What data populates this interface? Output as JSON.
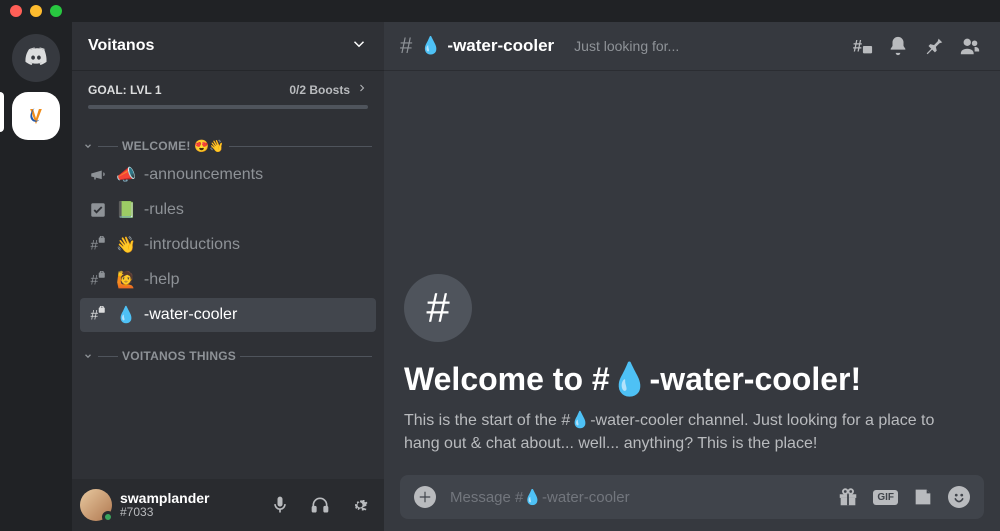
{
  "titlebar": {},
  "server_rail": {
    "home_label": "Home",
    "active_server_label": "Voitanos"
  },
  "sidebar": {
    "server_name": "Voitanos",
    "boost": {
      "goal_label": "GOAL: LVL 1",
      "count_label": "0/2 Boosts"
    },
    "categories": [
      {
        "label": "WELCOME! 😍👋",
        "channels": [
          {
            "icon": "announce-hash",
            "emoji": "📣",
            "label": "-announcements"
          },
          {
            "icon": "check",
            "emoji": "📗",
            "label": "-rules"
          },
          {
            "icon": "lock-hash",
            "emoji": "👋",
            "label": "-introductions"
          },
          {
            "icon": "lock-hash",
            "emoji": "🙋",
            "label": "-help"
          },
          {
            "icon": "lock-hash",
            "emoji": "💧",
            "label": "-water-cooler",
            "selected": true
          }
        ]
      },
      {
        "label": "VOITANOS THINGS",
        "channels": []
      }
    ]
  },
  "user": {
    "name": "swamplander",
    "discriminator": "#7033"
  },
  "main": {
    "header": {
      "channel_emoji": "💧",
      "channel_name": "-water-cooler",
      "topic_preview": "Just looking for..."
    },
    "welcome": {
      "title_prefix": "Welcome to #",
      "title_emoji": "💧",
      "title_suffix": "-water-cooler!",
      "description": "This is the start of the #💧-water-cooler channel. Just looking for a place to hang out & chat about... well... anything? This is the place!"
    },
    "input": {
      "placeholder": "Message #💧-water-cooler"
    }
  }
}
